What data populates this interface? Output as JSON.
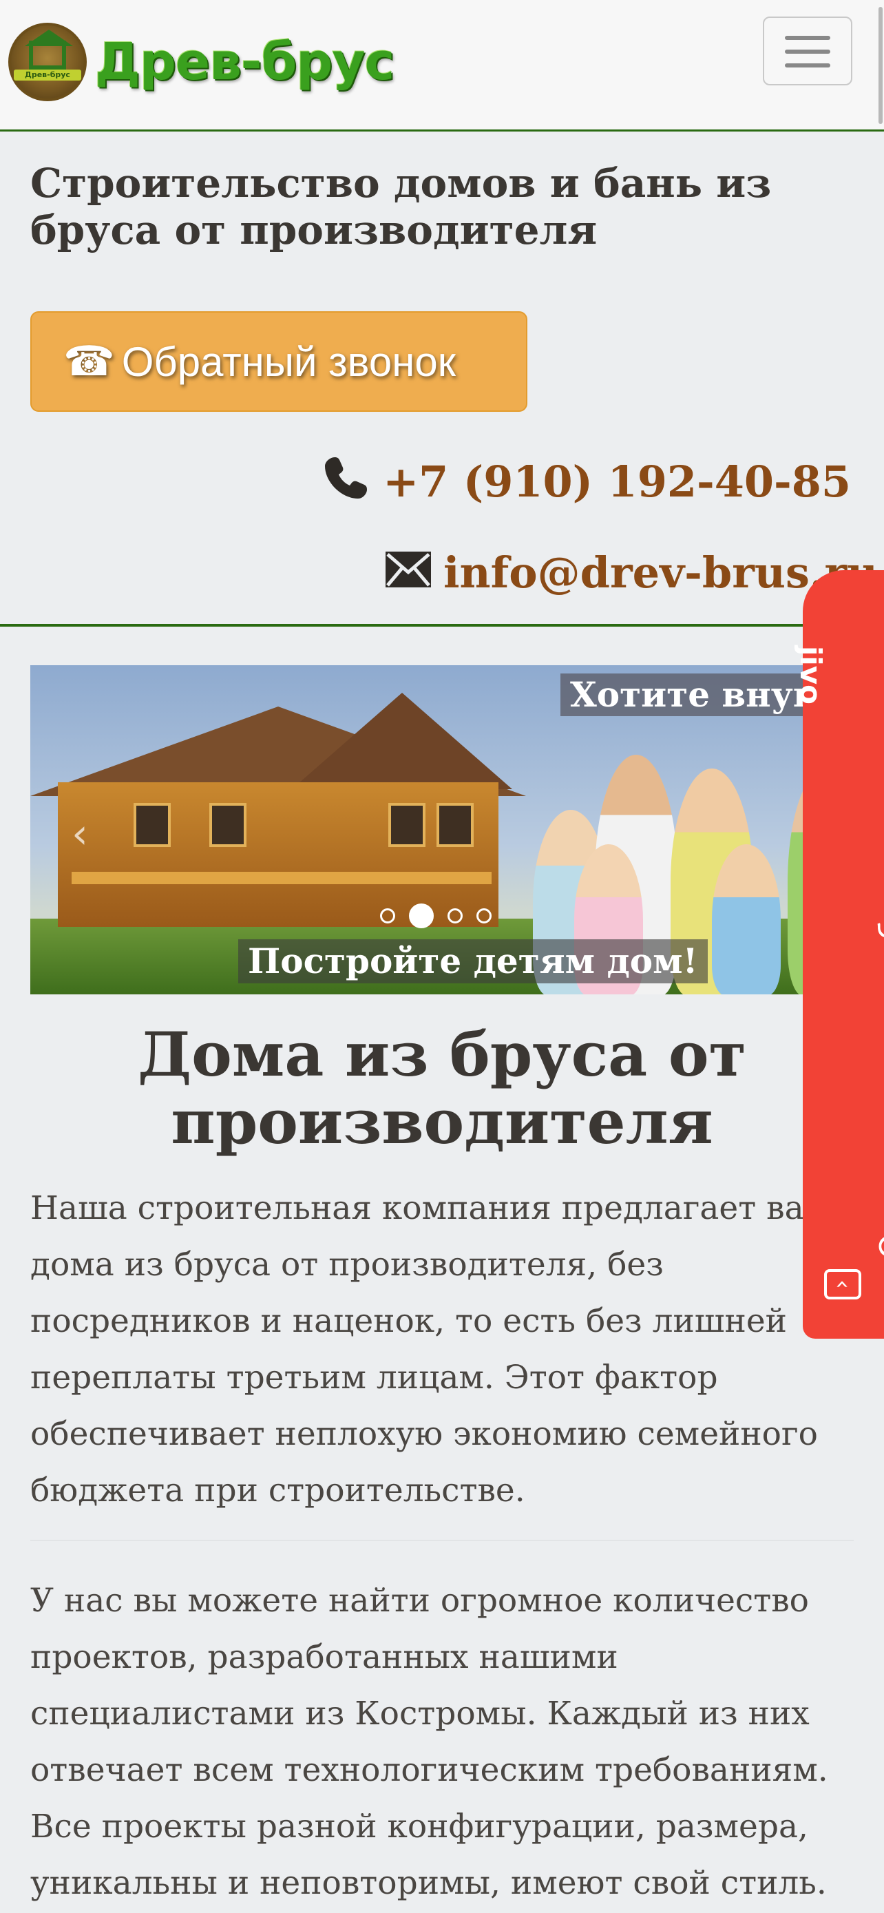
{
  "brand": {
    "name": "Древ-брус",
    "emblem_text": "Древ-брус"
  },
  "header": {
    "tagline": "Строительство домов и бань из бруса от производителя",
    "callback_icon": "☎",
    "callback_label": "Обратный звонок",
    "phone": "+7 (910) 192-40-85",
    "email": "info@drev-brus.ru"
  },
  "carousel": {
    "caption_top": "Хотите внуков?",
    "caption_bottom": "Постройте детям дом!",
    "active_slide": 2,
    "slide_count": 4
  },
  "main": {
    "heading": "Дома из бруса от производителя",
    "paragraph1": "Наша строительная компания предлагает вам дома из бруса от производителя, без посредников и наценок, то есть без лишней переплаты третьим лицам. Этот фактор обеспечивает неплохую экономию семейного бюджета при строительстве.",
    "paragraph2": "У нас вы можете найти огромное количество проектов, разработанных нашими специалистами из Костромы. Каждый из них отвечает всем технологическим требованиям. Все проекты разной конфигурации, размера, уникальны и неповторимы, имеют свой стиль."
  },
  "jivo": {
    "logo": "jivo",
    "label": "Отправьте нам сообщение"
  },
  "colors": {
    "brand_green": "#3aa01e",
    "accent_orange": "#efad4f",
    "link_brown": "#8a4a16",
    "jivo_red": "#f24236"
  }
}
